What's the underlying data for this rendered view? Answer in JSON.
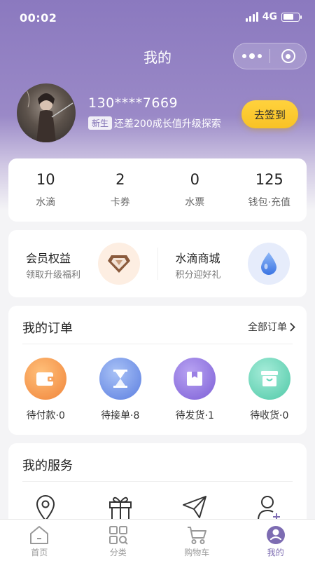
{
  "status_bar": {
    "time": "00:02",
    "network": "4G"
  },
  "header": {
    "title": "我的"
  },
  "profile": {
    "phone": "130****7669",
    "badge": "新生",
    "growth_text": "还差200成长值升级探索",
    "signin_label": "去签到"
  },
  "stats": [
    {
      "value": "10",
      "label": "水滴"
    },
    {
      "value": "2",
      "label": "卡券"
    },
    {
      "value": "0",
      "label": "水票"
    },
    {
      "value": "125",
      "label": "钱包·充值"
    }
  ],
  "perks": [
    {
      "title": "会员权益",
      "subtitle": "领取升级福利",
      "icon": "diamond-icon"
    },
    {
      "title": "水滴商城",
      "subtitle": "积分迎好礼",
      "icon": "water-drop-icon"
    }
  ],
  "orders": {
    "title": "我的订单",
    "all_label": "全部订单",
    "items": [
      {
        "label": "待付款·0",
        "icon": "wallet-icon",
        "color": "#f29a4a"
      },
      {
        "label": "待接单·8",
        "icon": "hourglass-icon",
        "color": "#6f8fe0"
      },
      {
        "label": "待发货·1",
        "icon": "box-icon",
        "color": "#8b6fd8"
      },
      {
        "label": "待收货·0",
        "icon": "basket-icon",
        "color": "#5fd3b5"
      }
    ]
  },
  "services": {
    "title": "我的服务",
    "icons": [
      "location-icon",
      "gift-icon",
      "send-icon",
      "add-user-icon"
    ]
  },
  "tabbar": [
    {
      "label": "首页",
      "icon": "home-icon"
    },
    {
      "label": "分类",
      "icon": "category-icon"
    },
    {
      "label": "购物车",
      "icon": "cart-icon"
    },
    {
      "label": "我的",
      "icon": "profile-icon",
      "active": true
    }
  ]
}
